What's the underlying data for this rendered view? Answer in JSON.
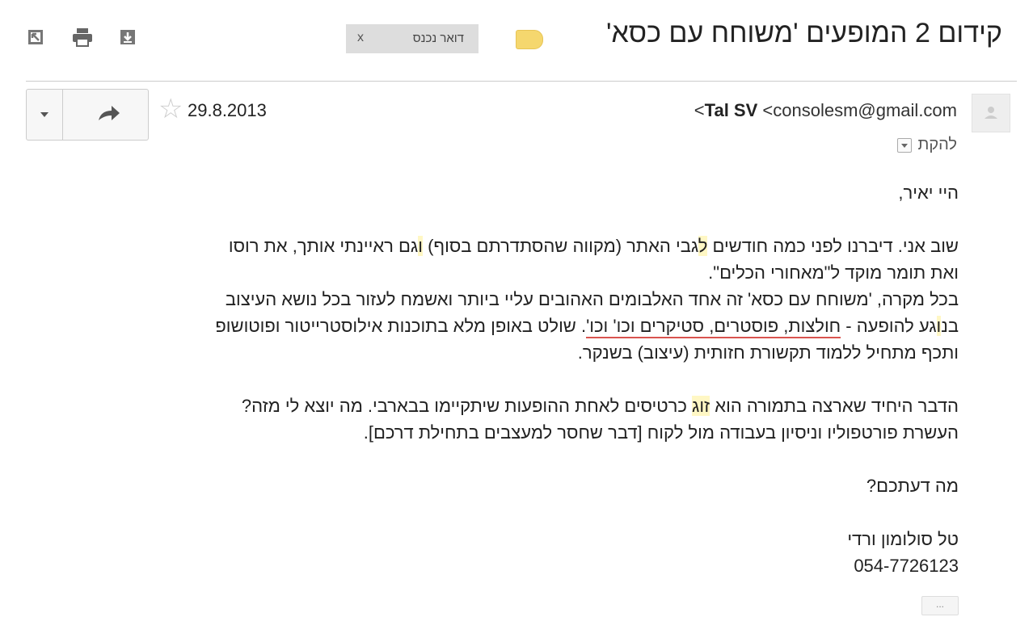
{
  "subject": "קידום 2 המופעים 'משוחח עם כסא'",
  "label_chip": {
    "text": "דואר נכנס",
    "close": "x"
  },
  "toolbar_icons": [
    "open-in-new-window-icon",
    "print-icon",
    "download-icon"
  ],
  "colors": {
    "label_tag": "#f5d76e",
    "highlight": "#fff7c4",
    "underline": "#d9534f"
  },
  "sender": {
    "name": "Tal SV",
    "email": "<consolesm@gmail.com>"
  },
  "to_line": "להקת",
  "date": "29.8.2013",
  "body": {
    "greeting": "היי יאיר,",
    "p1_l1_a": "שוב אני. דיברנו לפני כמה חודשים ",
    "p1_l1_h1": "ל",
    "p1_l1_b": "גבי האתר (מקווה שהסתדרתם בסוף) ",
    "p1_l1_h2": "ו",
    "p1_l1_c": "גם ראיינתי אותך, את רוסו",
    "p1_l2": "ואת תומר מוקד ל\"מאחורי הכלים\".",
    "p1_l3": "בכל מקרה, 'משוחח עם כסא' זה אחד האלבומים האהובים עליי ביותר ואשמח לעזור בכל נושא העיצוב",
    "p1_l4_a": "בנ",
    "p1_l4_h": "ו",
    "p1_l4_b": "גע להופעה - ",
    "p1_l4_ul": "חולצות, פוסטרים, סטיקרים וכו' וכו'",
    "p1_l4_c": ". שולט באופן מלא בתוכנות אילוסטרייטור ופוטושופ",
    "p1_l5": "ותכף מתחיל ללמוד תקשורת חזותית (עיצוב) בשנקר.",
    "p2_l1_a": "הדבר היחיד שארצה בתמורה הוא ",
    "p2_l1_h": "זוג",
    "p2_l1_b": " כרטיסים לאחת ההופעות שיתקיימו בבארבי. מה יוצא לי מזה?",
    "p2_l2": "העשרת פורטפוליו וניסיון בעבודה מול לקוח [דבר שחסר למעצבים בתחילת דרכם].",
    "question": "מה דעתכם?",
    "sig_name": "טל סולומון ורדי",
    "sig_phone": "054-7726123"
  },
  "more_label": "..."
}
